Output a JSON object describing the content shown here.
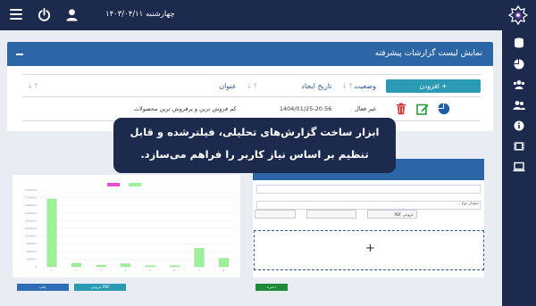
{
  "topbar": {
    "date": "چهارشنبه ۱۴۰۳/۰۴/۱۱",
    "menu_icon": "hamburger-icon",
    "power_icon": "power-icon",
    "user_icon": "user-icon",
    "logo": "app-logo"
  },
  "sidebar": {
    "items": [
      {
        "icon": "database-icon"
      },
      {
        "icon": "pie-chart-icon"
      },
      {
        "icon": "users-icon"
      },
      {
        "icon": "user-group-icon"
      },
      {
        "icon": "info-icon"
      },
      {
        "icon": "film-icon"
      },
      {
        "icon": "laptop-icon"
      }
    ]
  },
  "panel": {
    "title": "نمایش لیست گزارشات پیشرفته",
    "collapse_icon": "minus-icon"
  },
  "table": {
    "headers": {
      "title": "عنوان",
      "created": "تاریخ ایجاد",
      "status": "وضعیت"
    },
    "add_label": "+ افزودن",
    "rows": [
      {
        "title": "کم فروش ترین و پرفروش ترین محصولات",
        "created": "1404/01/25-20:56",
        "status": "غیر فعال"
      }
    ],
    "ops_icons": [
      "delete-icon",
      "edit-icon",
      "pie-chart-icon"
    ]
  },
  "tooltip": {
    "line1": "ابزار ساخت گزارش‌های تحلیلی، فیلترشده و قابل",
    "line2": "تنظیم بر اساس نیاز کاربر را فراهم می‌سازد."
  },
  "chart_data": {
    "type": "bar",
    "categories": [
      "1",
      "2",
      "3",
      "4",
      "5",
      "6",
      "7",
      "8"
    ],
    "series": [
      {
        "values": [
          2650000,
          130000,
          60000,
          120000,
          40000,
          40000,
          720000,
          330000
        ]
      },
      {
        "values": []
      }
    ],
    "ylabel": "",
    "xlabel": "",
    "ylim": [
      0,
      3000000
    ],
    "grid": true,
    "legend": "top-center",
    "colors": {
      "series1": "#9ef09a",
      "series2": "#e84fd5"
    }
  },
  "chart_buttons": {
    "print": "چاپ",
    "pdf": "خروجی PDF"
  },
  "form": {
    "field1_label": "",
    "field2_label": "نمودار نوع ...",
    "select1": "",
    "select2": "",
    "select3": "خروجی PDF",
    "checkbox_label": "",
    "save_label": "ذخیره"
  },
  "colors": {
    "navbar": "#1b2a4d",
    "panel_header": "#2c66a6",
    "add_button": "#2a9bb3",
    "delete": "#d9342b",
    "edit": "#2e9a3c",
    "chart_icon": "#1f5fa8"
  }
}
